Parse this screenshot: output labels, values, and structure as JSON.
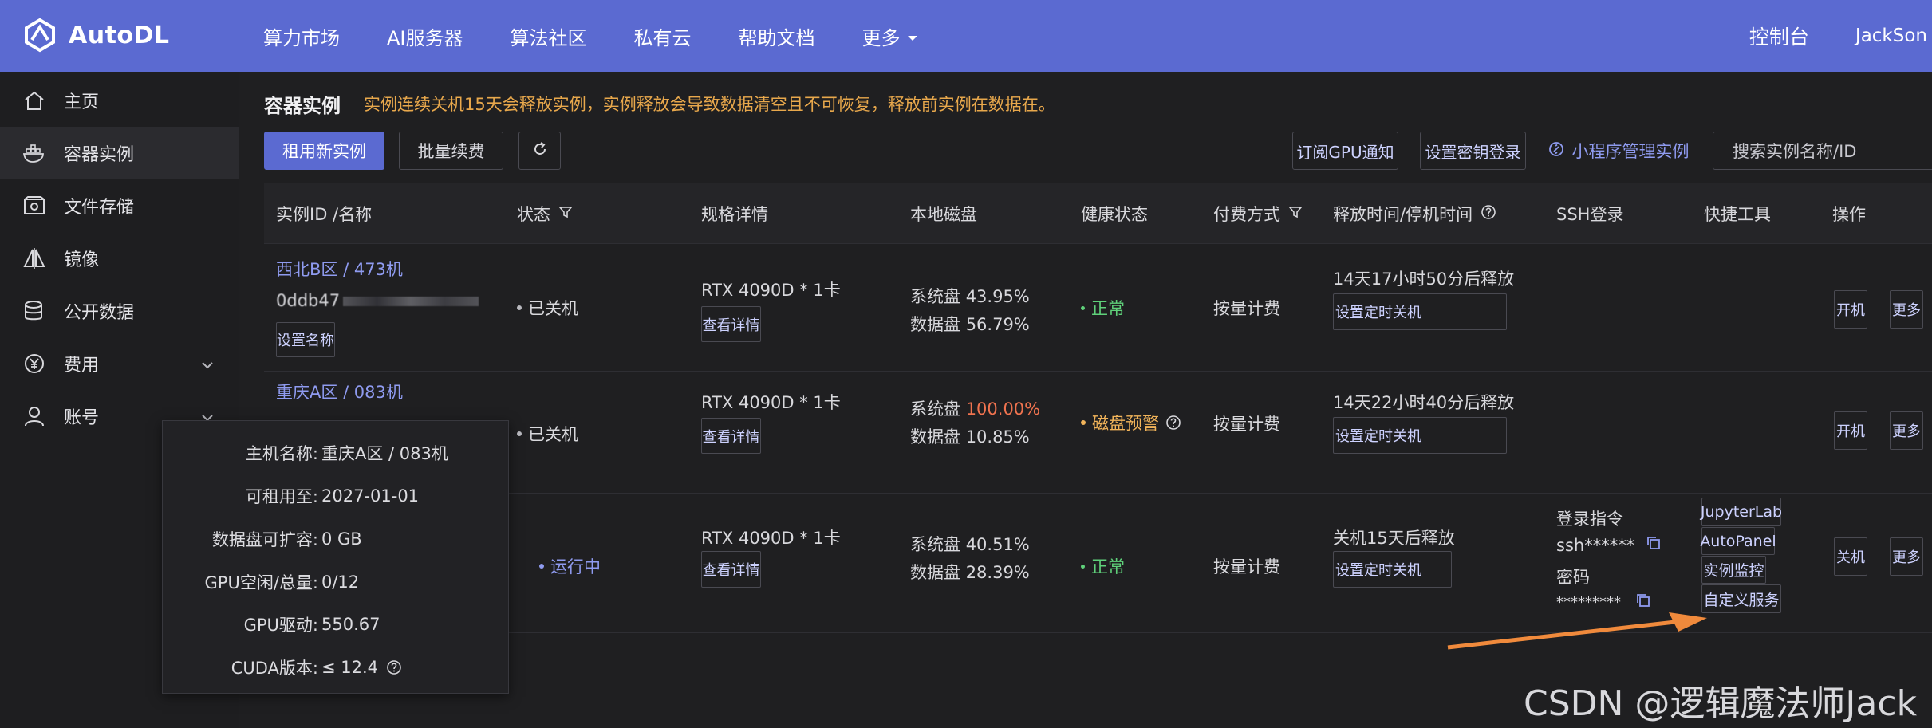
{
  "brand": {
    "name": "AutoDL"
  },
  "nav": {
    "items": [
      "算力市场",
      "AI服务器",
      "算法社区",
      "私有云",
      "帮助文档"
    ],
    "more_label": "更多",
    "console": "控制台",
    "user": "JackSon"
  },
  "sidebar": {
    "items": [
      {
        "label": "主页",
        "icon": "home-icon"
      },
      {
        "label": "容器实例",
        "icon": "docker-icon"
      },
      {
        "label": "文件存储",
        "icon": "storage-icon"
      },
      {
        "label": "镜像",
        "icon": "mirror-icon"
      },
      {
        "label": "公开数据",
        "icon": "database-icon"
      },
      {
        "label": "费用",
        "icon": "yen-icon"
      },
      {
        "label": "账号",
        "icon": "user-icon"
      }
    ]
  },
  "page": {
    "title": "容器实例",
    "notice": "实例连续关机15天会释放实例，实例释放会导致数据清空且不可恢复，释放前实例在数据在。"
  },
  "toolbar": {
    "rent_new": "租用新实例",
    "batch_renew": "批量续费",
    "subscribe_gpu": "订阅GPU通知",
    "set_key_login": "设置密钥登录",
    "miniprogram": "小程序管理实例",
    "search_placeholder": "搜索实例名称/ID"
  },
  "table": {
    "headers": {
      "id_name": "实例ID /名称",
      "status": "状态",
      "spec": "规格详情",
      "disk": "本地磁盘",
      "health": "健康状态",
      "billing": "付费方式",
      "release": "释放时间/停机时间",
      "ssh": "SSH登录",
      "tools": "快捷工具",
      "actions": "操作"
    },
    "rows": [
      {
        "region": "西北B区 / 473机",
        "id": "0ddb47",
        "set_name": "设置名称",
        "status": "已关机",
        "spec": "RTX 4090D * 1卡",
        "spec_detail": "查看详情",
        "sys_disk_label": "系统盘",
        "sys_disk": "43.95%",
        "data_disk_label": "数据盘",
        "data_disk": "56.79%",
        "health": "正常",
        "billing": "按量计费",
        "release": "14天17小时50分后释放",
        "timer": "设置定时关机",
        "power": "开机",
        "more": "更多"
      },
      {
        "region": "重庆A区 / 083机",
        "status": "已关机",
        "spec": "RTX 4090D * 1卡",
        "spec_detail": "查看详情",
        "sys_disk_label": "系统盘",
        "sys_disk": "100.00%",
        "data_disk_label": "数据盘",
        "data_disk": "10.85%",
        "health": "磁盘预警",
        "billing": "按量计费",
        "release": "14天22小时40分后释放",
        "timer": "设置定时关机",
        "power": "开机",
        "more": "更多"
      },
      {
        "status": "运行中",
        "spec": "RTX 4090D * 1卡",
        "spec_detail": "查看详情",
        "sys_disk_label": "系统盘",
        "sys_disk": "40.51%",
        "data_disk_label": "数据盘",
        "data_disk": "28.39%",
        "health": "正常",
        "billing": "按量计费",
        "release": "关机15天后释放",
        "timer": "设置定时关机",
        "ssh_cmd_label": "登录指令",
        "ssh_cmd": "ssh******",
        "ssh_pwd_label": "密码",
        "ssh_pwd": "*********",
        "tools": [
          "JupyterLab",
          "AutoPanel",
          "实例监控",
          "自定义服务"
        ],
        "power": "关机",
        "more": "更多"
      }
    ]
  },
  "tooltip": {
    "host_name_k": "主机名称:",
    "host_name_v": "重庆A区 / 083机",
    "rent_until_k": "可租用至:",
    "rent_until_v": "2027-01-01",
    "expand_k": "数据盘可扩容:",
    "expand_v": "0 GB",
    "gpu_k": "GPU空闲/总量:",
    "gpu_v": "0/12",
    "driver_k": "GPU驱动:",
    "driver_v": "550.67",
    "cuda_k": "CUDA版本:",
    "cuda_v": "≤ 12.4"
  },
  "watermark": "CSDN @逻辑魔法师Jack",
  "colors": {
    "nav": "#5b6ad1",
    "accent": "#8f9bf0",
    "warn": "#e8a84c",
    "danger": "#f0734f",
    "ok": "#5fd17a",
    "arrow": "#f08a3c"
  }
}
